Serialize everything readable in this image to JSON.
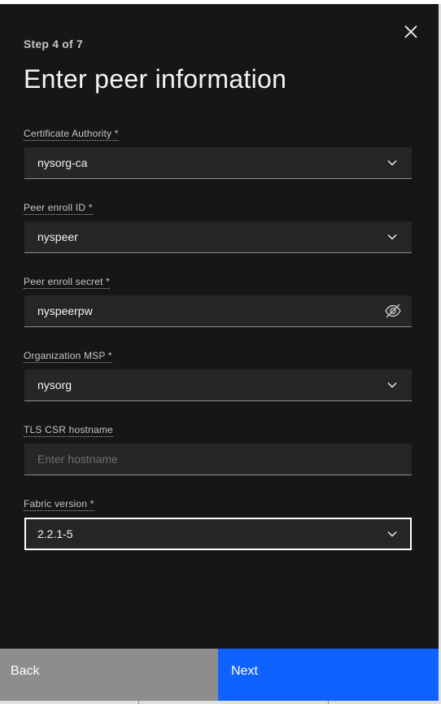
{
  "step": "Step 4 of 7",
  "title": "Enter peer information",
  "fields": {
    "ca": {
      "label": "Certificate Authority *",
      "value": "nysorg-ca"
    },
    "enroll_id": {
      "label": "Peer enroll ID *",
      "value": "nyspeer"
    },
    "enroll_secret": {
      "label": "Peer enroll secret *",
      "value": "nyspeerpw"
    },
    "msp": {
      "label": "Organization MSP *",
      "value": "nysorg"
    },
    "tls_hostname": {
      "label": "TLS CSR hostname",
      "value": "",
      "placeholder": "Enter hostname"
    },
    "fabric_version": {
      "label": "Fabric version *",
      "value": "2.2.1-5"
    }
  },
  "buttons": {
    "back": "Back",
    "next": "Next"
  },
  "icons": {
    "close": "close-icon",
    "chevron": "chevron-down-icon",
    "visibility": "view-off-icon"
  },
  "colors": {
    "panel_bg": "#161616",
    "field_bg": "#262626",
    "primary": "#0f62fe",
    "secondary": "#8d8d8d"
  }
}
